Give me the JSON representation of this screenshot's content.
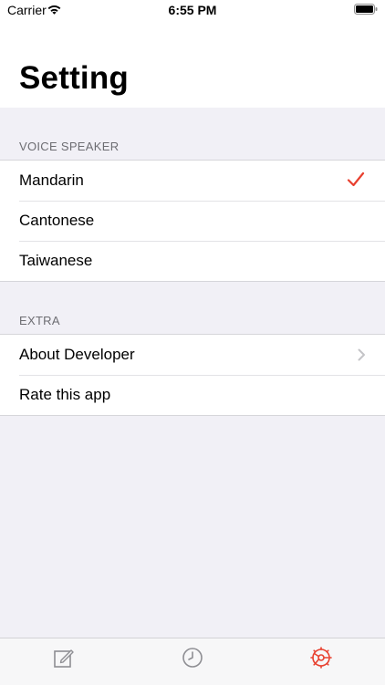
{
  "status_bar": {
    "carrier": "Carrier",
    "time": "6:55 PM"
  },
  "page": {
    "title": "Setting"
  },
  "sections": {
    "voice": {
      "header": "VOICE SPEAKER",
      "items": [
        {
          "label": "Mandarin",
          "selected": true
        },
        {
          "label": "Cantonese",
          "selected": false
        },
        {
          "label": "Taiwanese",
          "selected": false
        }
      ]
    },
    "extra": {
      "header": "EXTRA",
      "items": [
        {
          "label": "About Developer",
          "accessory": "chevron-right-icon"
        },
        {
          "label": "Rate this app",
          "accessory": ""
        }
      ]
    }
  },
  "tab_bar": {
    "tabs": [
      {
        "icon": "compose-icon",
        "active": false
      },
      {
        "icon": "clock-icon",
        "active": false
      },
      {
        "icon": "settings-gear-icon",
        "active": true
      }
    ]
  },
  "colors": {
    "accent": "#e8402f",
    "background": "#f1f0f6",
    "tab_inactive": "#8e8e93"
  }
}
